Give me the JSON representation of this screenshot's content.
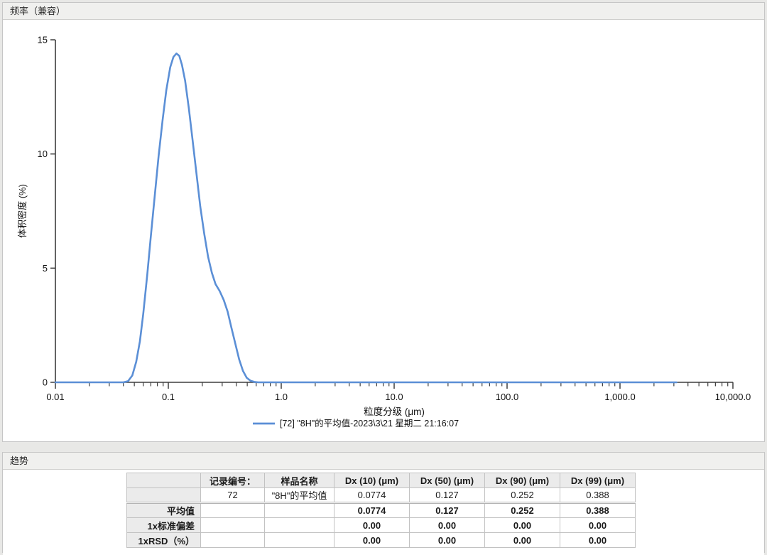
{
  "frequency_panel": {
    "title": "频率（兼容）"
  },
  "trend_panel": {
    "title": "趋势",
    "table": {
      "headers": [
        "记录编号：",
        "样品名称",
        "Dx (10) (μm)",
        "Dx (50) (μm)",
        "Dx (90) (μm)",
        "Dx (99) (μm)"
      ],
      "rows": [
        {
          "label": "",
          "bold": false,
          "cells": [
            "72",
            "\"8H\"的平均值",
            "0.0774",
            "0.127",
            "0.252",
            "0.388"
          ]
        },
        {
          "label": "平均值",
          "bold": true,
          "cells": [
            "",
            "",
            "0.0774",
            "0.127",
            "0.252",
            "0.388"
          ]
        },
        {
          "label": "1x标准偏差",
          "bold": true,
          "cells": [
            "",
            "",
            "0.00",
            "0.00",
            "0.00",
            "0.00"
          ]
        },
        {
          "label": "1xRSD（%）",
          "bold": true,
          "cells": [
            "",
            "",
            "0.00",
            "0.00",
            "0.00",
            "0.00"
          ]
        }
      ]
    }
  },
  "chart_data": {
    "type": "line",
    "title": "频率（兼容）",
    "xlabel": "粒度分级 (μm)",
    "ylabel": "体积密度 (%)",
    "x_scale": "log",
    "xlim": [
      0.01,
      10000
    ],
    "ylim": [
      0,
      15
    ],
    "x_tick_labels": [
      "0.01",
      "0.1",
      "1.0",
      "10.0",
      "100.0",
      "1,000.0",
      "10,000.0"
    ],
    "y_ticks": [
      0,
      5,
      10,
      15
    ],
    "grid": "off",
    "legend_position": "bottom-center",
    "line_color": "#5b8fd6",
    "axis_color": "#3d3d3d",
    "series": [
      {
        "name": "[72] \"8H\"的平均值-2023\\3\\21 星期二 21:16:07",
        "peak_value": 14.4,
        "peak_x_um": 0.12,
        "points": [
          [
            0.01,
            0
          ],
          [
            0.02,
            0
          ],
          [
            0.03,
            0
          ],
          [
            0.04,
            0
          ],
          [
            0.044,
            0.05
          ],
          [
            0.048,
            0.3
          ],
          [
            0.052,
            0.9
          ],
          [
            0.056,
            1.8
          ],
          [
            0.06,
            3.0
          ],
          [
            0.065,
            4.7
          ],
          [
            0.07,
            6.4
          ],
          [
            0.076,
            8.2
          ],
          [
            0.082,
            9.9
          ],
          [
            0.089,
            11.5
          ],
          [
            0.096,
            12.8
          ],
          [
            0.104,
            13.8
          ],
          [
            0.111,
            14.25
          ],
          [
            0.118,
            14.4
          ],
          [
            0.125,
            14.3
          ],
          [
            0.132,
            13.9
          ],
          [
            0.141,
            13.2
          ],
          [
            0.152,
            12.0
          ],
          [
            0.164,
            10.6
          ],
          [
            0.178,
            9.1
          ],
          [
            0.192,
            7.7
          ],
          [
            0.208,
            6.5
          ],
          [
            0.225,
            5.5
          ],
          [
            0.243,
            4.8
          ],
          [
            0.262,
            4.3
          ],
          [
            0.285,
            4.0
          ],
          [
            0.31,
            3.6
          ],
          [
            0.335,
            3.1
          ],
          [
            0.362,
            2.4
          ],
          [
            0.392,
            1.7
          ],
          [
            0.424,
            1.0
          ],
          [
            0.458,
            0.5
          ],
          [
            0.495,
            0.2
          ],
          [
            0.535,
            0.07
          ],
          [
            0.578,
            0.02
          ],
          [
            0.625,
            0
          ],
          [
            1.0,
            0
          ],
          [
            10.0,
            0
          ],
          [
            100.0,
            0
          ],
          [
            1000.0,
            0
          ],
          [
            3162.0,
            0
          ]
        ]
      }
    ]
  }
}
